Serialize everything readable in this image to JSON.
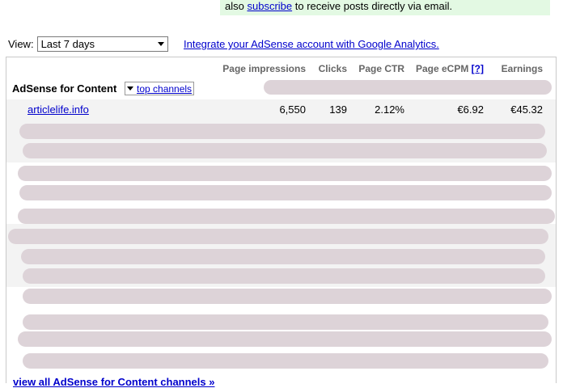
{
  "notice": {
    "prefix": "also",
    "link": "subscribe",
    "suffix": "to receive posts directly via email."
  },
  "view": {
    "label": "View:",
    "selected": "Last 7 days"
  },
  "analytics_link": "Integrate your AdSense account with Google Analytics.",
  "table": {
    "headers": [
      "Page impressions",
      "Clicks",
      "Page CTR",
      "Page eCPM",
      "Earnings"
    ],
    "help_link": "[?]",
    "section_title": "AdSense for Content",
    "channel_button": "top channels",
    "rows": [
      {
        "name": "articlelife.info",
        "impressions": "6,550",
        "clicks": "139",
        "ctr": "2.12%",
        "ecpm": "€6.92",
        "earnings": "€45.32"
      }
    ]
  },
  "footer_link": "view all AdSense for Content channels »"
}
